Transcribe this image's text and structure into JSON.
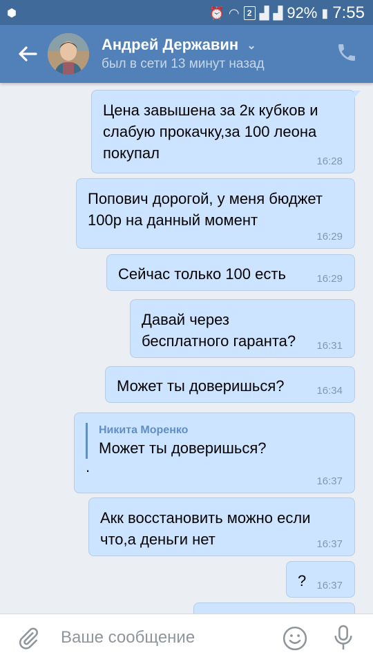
{
  "status_bar": {
    "battery": "92%",
    "time": "7:55",
    "sim_number": "2"
  },
  "header": {
    "name": "Андрей Державин",
    "status": "был в сети 13 минут назад"
  },
  "messages": [
    {
      "text": "Цена завышена за 2к кубков и слабую прокачку,за 100 леона покупал",
      "time": "16:28"
    },
    {
      "text": "Попович дорогой, у меня бюджет 100р на данный момент",
      "time": "16:29"
    },
    {
      "text": "Сейчас только 100 есть",
      "time": "16:29"
    },
    {
      "text": "Давай через бесплатного гаранта?",
      "time": "16:31"
    },
    {
      "text": "Может ты доверишься?",
      "time": "16:34"
    },
    {
      "quote_author": "Никита Моренко",
      "quote_text": "Может ты доверишься?",
      "text": ".",
      "time": "16:37"
    },
    {
      "text": "Акк восстановить можно если что,а деньги нет",
      "time": "16:37"
    },
    {
      "text": "?",
      "time": "16:37"
    }
  ],
  "input": {
    "placeholder": "Ваше сообщение"
  },
  "colors": {
    "header": "#5181b8",
    "status_bar": "#3f6a9a",
    "bubble_out": "#cce4ff",
    "background": "#ebeef2"
  }
}
